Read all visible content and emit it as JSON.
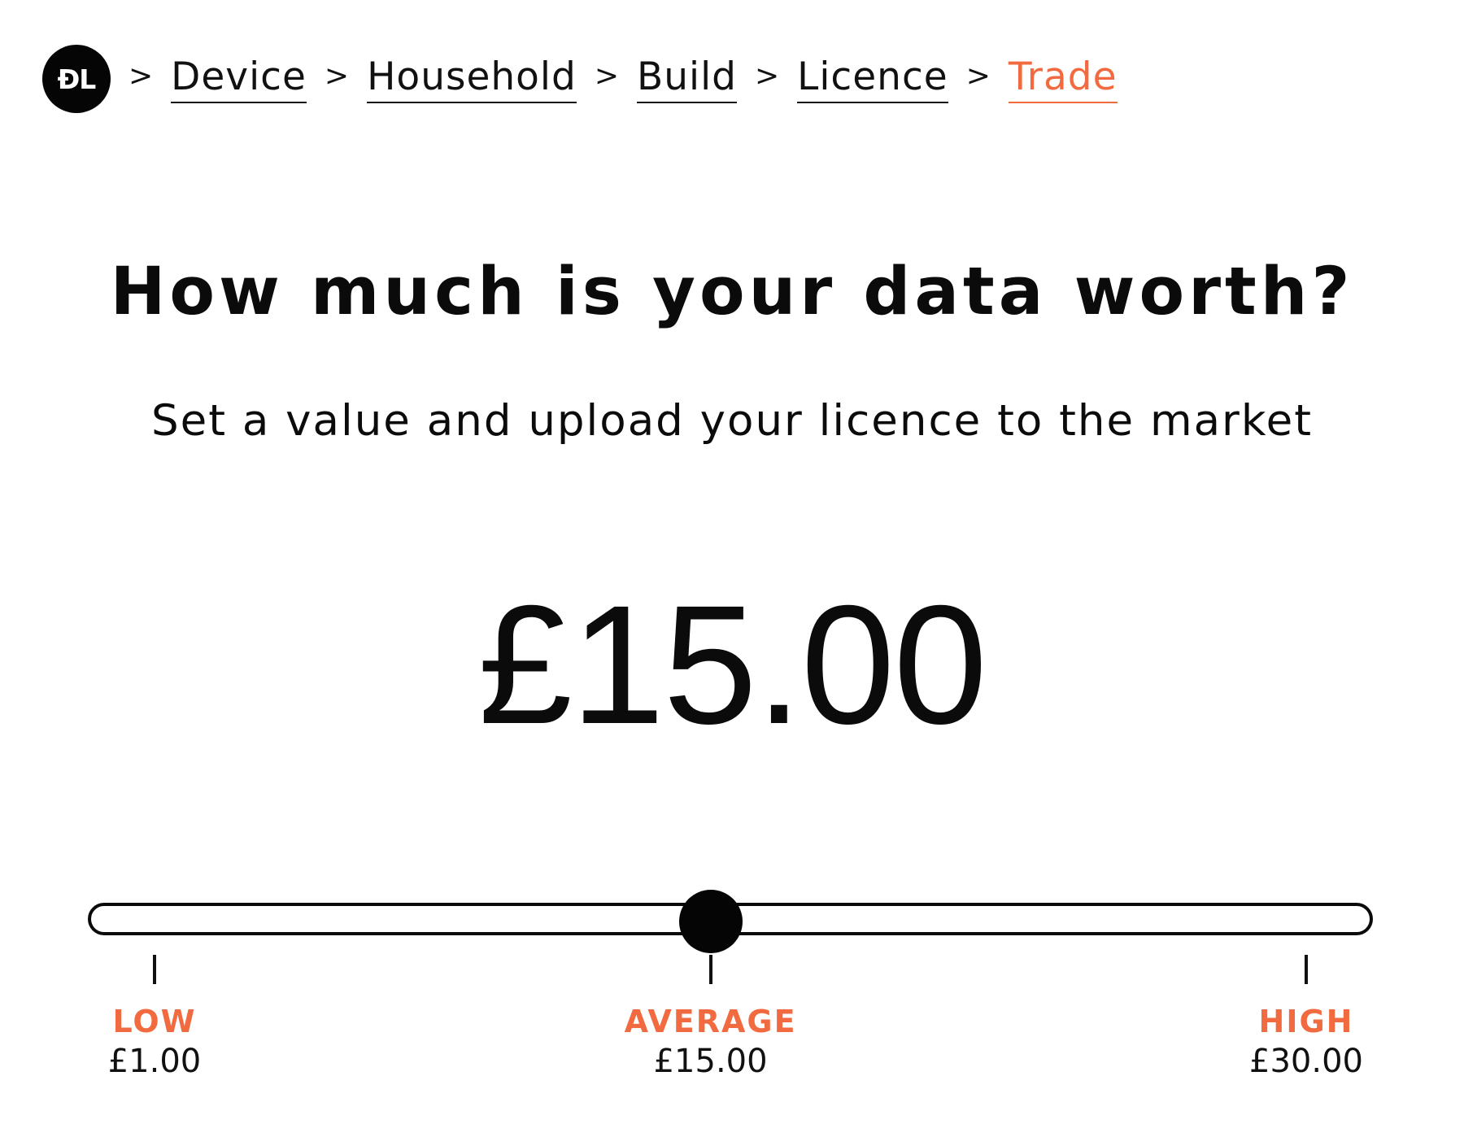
{
  "logo": {
    "text": "ĐL"
  },
  "breadcrumb": {
    "separator": ">",
    "items": [
      {
        "label": "Device",
        "active": false
      },
      {
        "label": "Household",
        "active": false
      },
      {
        "label": "Build",
        "active": false
      },
      {
        "label": "Licence",
        "active": false
      },
      {
        "label": "Trade",
        "active": true
      }
    ]
  },
  "heading": {
    "title": "How much is your data worth?",
    "subtitle": "Set a value and upload your licence to the market"
  },
  "price": {
    "display": "£15.00"
  },
  "slider": {
    "min": 1.0,
    "max": 30.0,
    "value": 15.0,
    "markers": [
      {
        "label": "LOW",
        "value_text": "£1.00",
        "value": 1.0
      },
      {
        "label": "AVERAGE",
        "value_text": "£15.00",
        "value": 15.0
      },
      {
        "label": "HIGH",
        "value_text": "£30.00",
        "value": 30.0
      }
    ]
  },
  "colors": {
    "accent": "#f26a3f",
    "text": "#0b0b0b",
    "background": "#ffffff"
  }
}
